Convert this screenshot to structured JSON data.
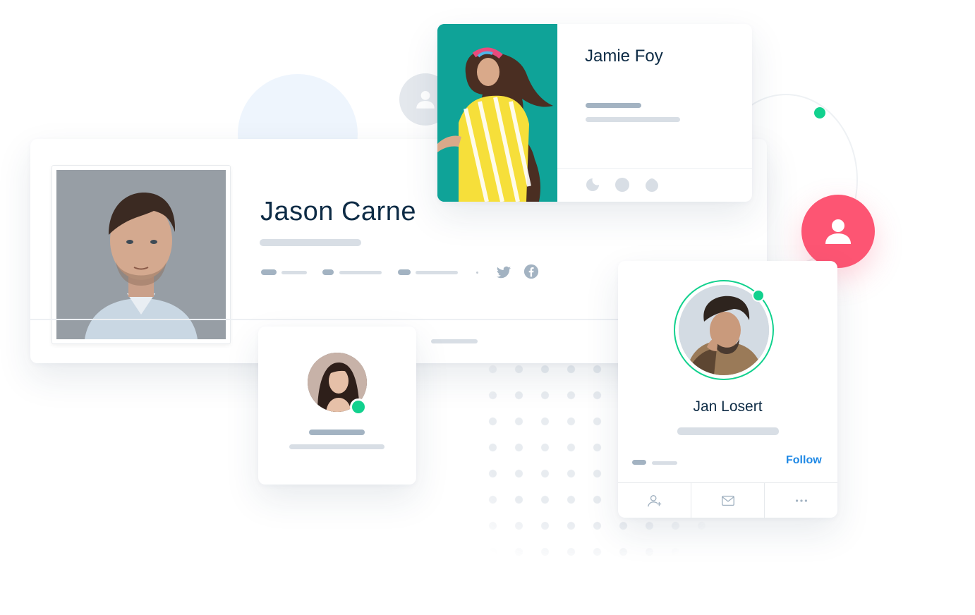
{
  "profiles": {
    "jason": {
      "name": "Jason Carne"
    },
    "jamie": {
      "name": "Jamie Foy"
    },
    "jan": {
      "name": "Jan Losert",
      "follow_label": "Follow"
    }
  },
  "icons": {
    "twitter": "twitter-icon",
    "facebook": "facebook-icon",
    "user": "user-icon",
    "add_friend": "add-friend-icon",
    "message": "envelope-icon",
    "more": "more-icon"
  },
  "colors": {
    "accent_green": "#12d18e",
    "accent_pink": "#fd5573",
    "link_blue": "#1e88e5",
    "teal_bg": "#0fa398",
    "placeholder_dark": "#a3b3c2",
    "placeholder_light": "#d8dee5"
  }
}
